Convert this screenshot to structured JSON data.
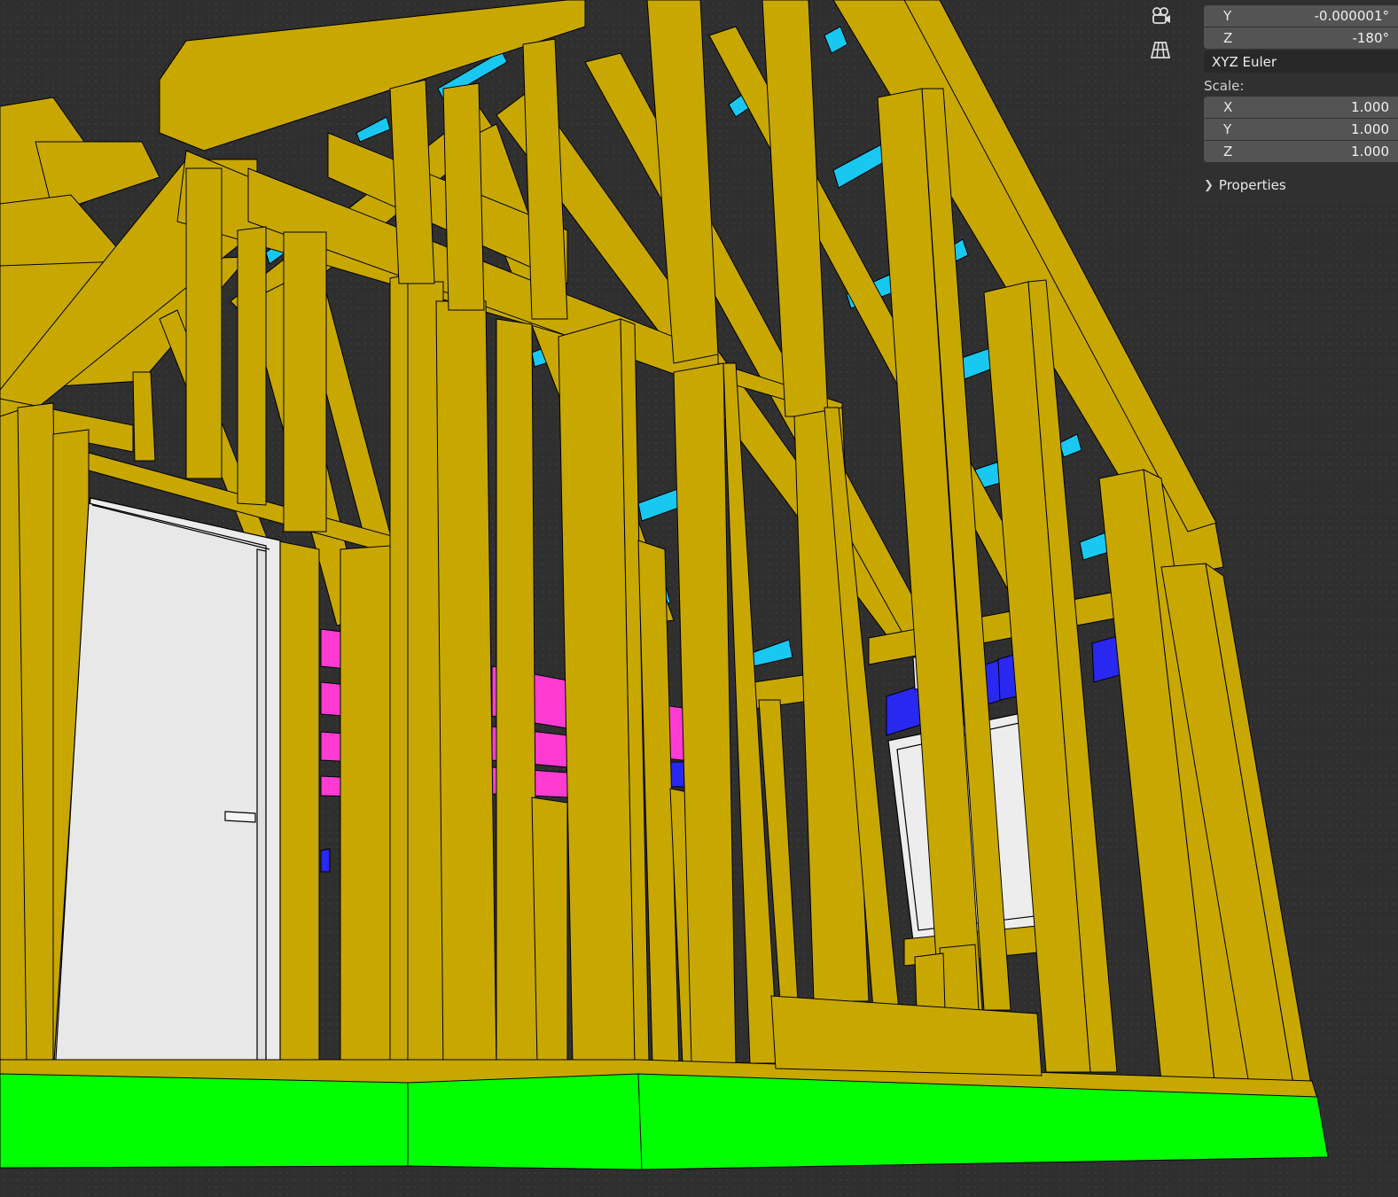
{
  "viewport": {
    "gizmos": [
      "camera-view-icon",
      "perspective-grid-icon"
    ]
  },
  "transform_panel": {
    "rotation": {
      "y": {
        "axis": "Y",
        "value": "-0.000001°"
      },
      "z": {
        "axis": "Z",
        "value": "-180°"
      }
    },
    "rotation_mode": "XYZ Euler",
    "scale_label": "Scale:",
    "scale": {
      "x": {
        "axis": "X",
        "value": "1.000"
      },
      "y": {
        "axis": "Y",
        "value": "1.000"
      },
      "z": {
        "axis": "Z",
        "value": "1.000"
      }
    },
    "properties_label": "Properties"
  },
  "colors": {
    "framing": "#c8a800",
    "floor": "#00ff00",
    "blocking_cyan": "#19c8f0",
    "joist_magenta": "#ff3cd2",
    "header_blue": "#2828f0",
    "door": "#ebebeb"
  }
}
